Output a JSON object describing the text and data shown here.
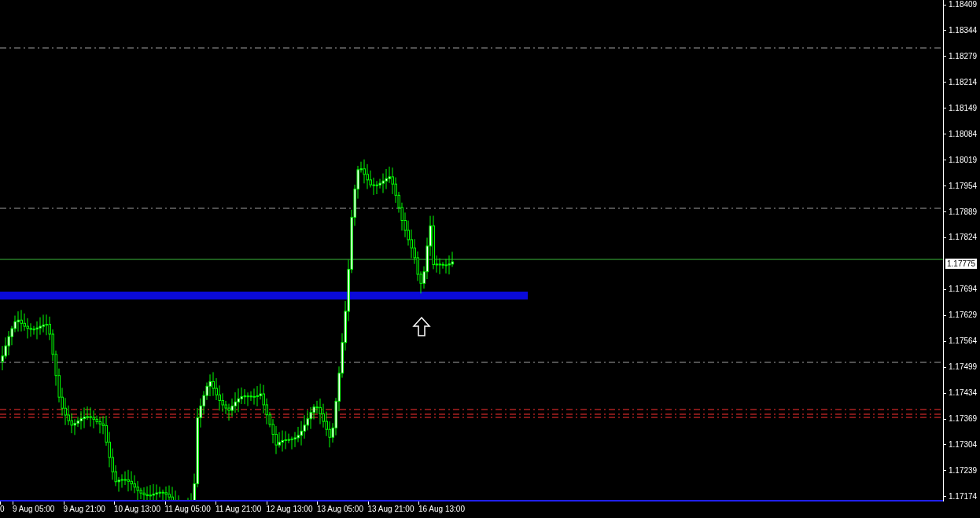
{
  "price_axis": {
    "labels": [
      {
        "kind": "tick",
        "text": "1.18409"
      },
      {
        "kind": "tick",
        "text": "1.18344"
      },
      {
        "kind": "tick",
        "text": "1.18279"
      },
      {
        "kind": "tick",
        "text": "1.18214"
      },
      {
        "kind": "tick",
        "text": "1.18149"
      },
      {
        "kind": "tick",
        "text": "1.18084"
      },
      {
        "kind": "tick",
        "text": "1.18019"
      },
      {
        "kind": "tick",
        "text": "1.17954"
      },
      {
        "kind": "tick",
        "text": "1.17889"
      },
      {
        "kind": "tick",
        "text": "1.17824"
      },
      {
        "kind": "current",
        "text": "1.17775"
      },
      {
        "kind": "tick",
        "text": "1.17694"
      },
      {
        "kind": "tick",
        "text": "1.17629"
      },
      {
        "kind": "tick",
        "text": "1.17564"
      },
      {
        "kind": "tick",
        "text": "1.17499"
      },
      {
        "kind": "tick",
        "text": "1.17434"
      },
      {
        "kind": "tick",
        "text": "1.17369"
      },
      {
        "kind": "tick",
        "text": "1.17304"
      },
      {
        "kind": "tick",
        "text": "1.17239"
      },
      {
        "kind": "tick",
        "text": "1.17174"
      }
    ]
  },
  "time_axis": {
    "labels": [
      "0",
      "9 Aug 05:00",
      "9 Aug 21:00",
      "10 Aug 13:00",
      "11 Aug 05:00",
      "11 Aug 21:00",
      "12 Aug 13:00",
      "13 Aug 05:00",
      "13 Aug 21:00",
      "16 Aug 13:00"
    ]
  }
}
